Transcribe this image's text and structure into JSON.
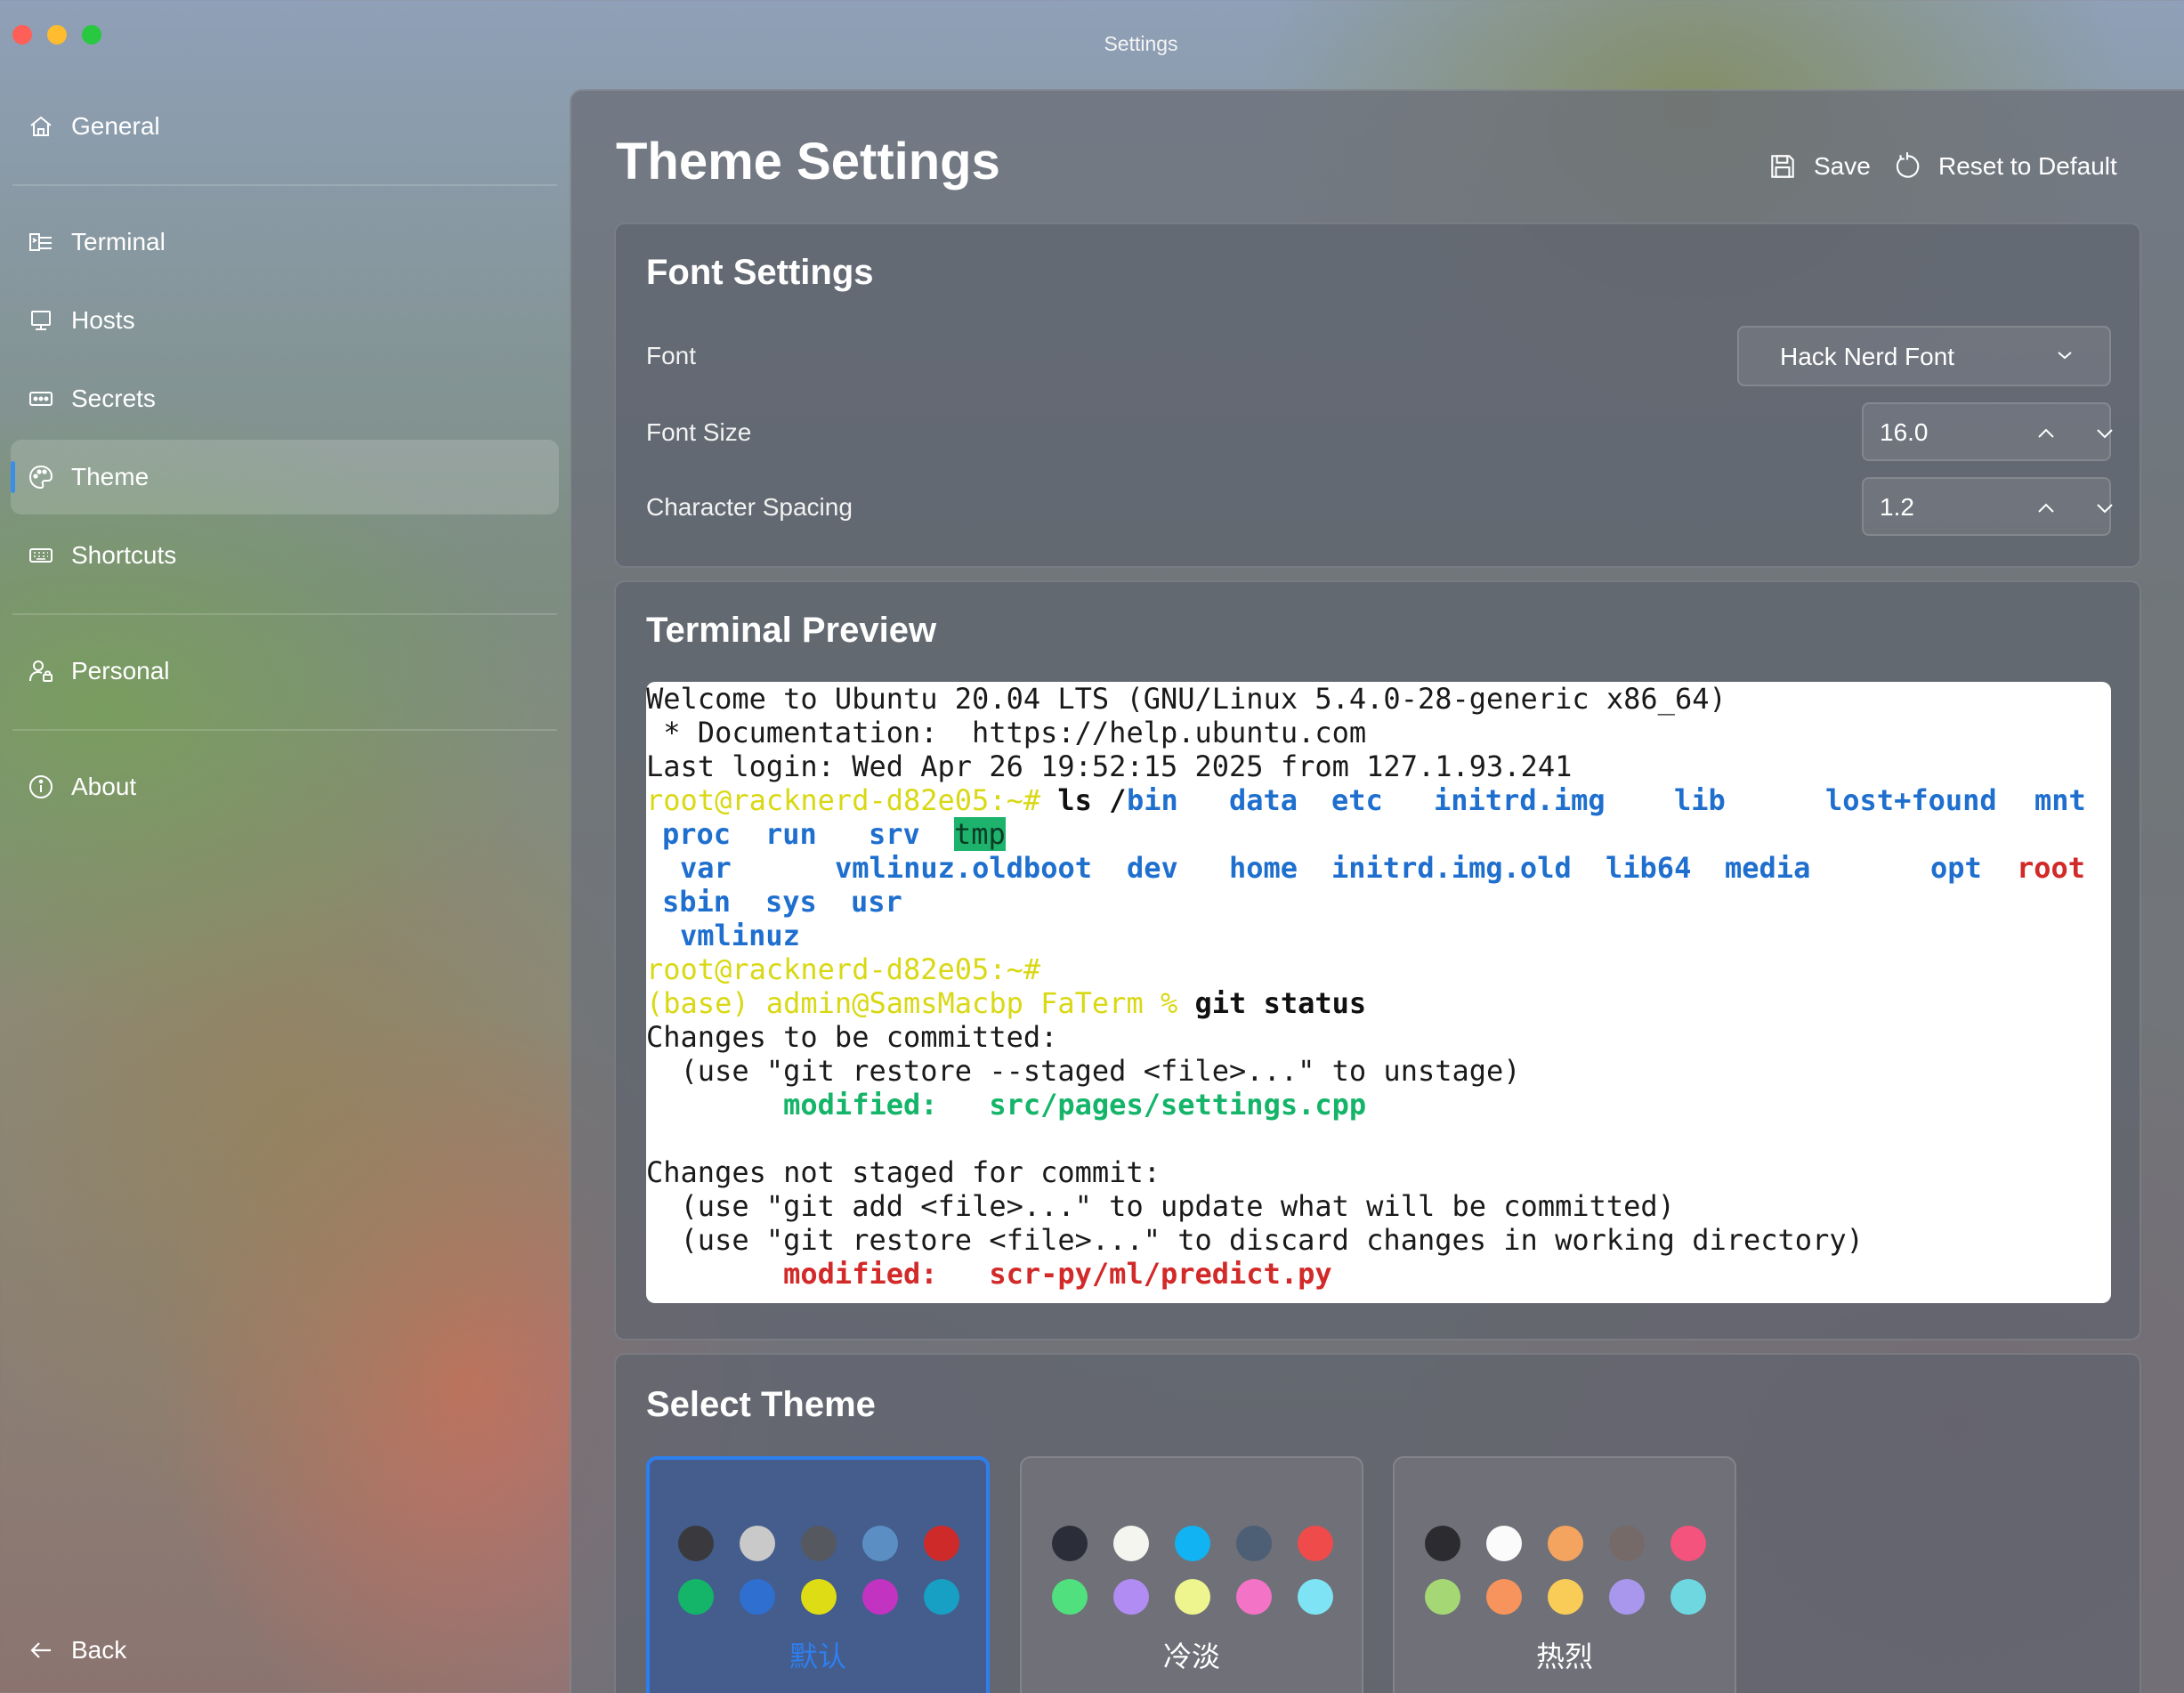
{
  "window": {
    "title": "Settings"
  },
  "sidebar": {
    "items": [
      {
        "label": "General",
        "icon": "home-icon"
      },
      {
        "label": "Terminal",
        "icon": "terminal-icon"
      },
      {
        "label": "Hosts",
        "icon": "monitor-icon"
      },
      {
        "label": "Secrets",
        "icon": "password-icon"
      },
      {
        "label": "Theme",
        "icon": "palette-icon",
        "active": true
      },
      {
        "label": "Shortcuts",
        "icon": "keyboard-icon"
      },
      {
        "label": "Personal",
        "icon": "person-lock-icon"
      },
      {
        "label": "About",
        "icon": "info-icon"
      }
    ],
    "back_label": "Back"
  },
  "header": {
    "title": "Theme Settings",
    "save_label": "Save",
    "reset_label": "Reset to Default"
  },
  "font_settings": {
    "title": "Font Settings",
    "font_label": "Font",
    "font_value": "Hack Nerd Font",
    "size_label": "Font Size",
    "size_value": "16.0",
    "spacing_label": "Character Spacing",
    "spacing_value": "1.2"
  },
  "terminal_preview": {
    "title": "Terminal Preview",
    "l1": "Welcome to Ubuntu 20.04 LTS (GNU/Linux 5.4.0-28-generic x86_64)",
    "l2": " * Documentation:  https://help.ubuntu.com",
    "l3": "Last login: Wed Apr 26 19:52:15 2025 from 127.1.93.241",
    "prompt1": "root@racknerd-d82e05:~#",
    "cmd1": " ls /",
    "ls_row1": [
      "bin",
      "data",
      "etc",
      "initrd.img",
      "lib",
      "lost+found",
      "mnt"
    ],
    "ls_row2": [
      "proc",
      "run",
      "srv",
      "tmp"
    ],
    "ls_row3": [
      "var",
      "vmlinuz.oldboot",
      "dev",
      "home",
      "initrd.img.old",
      "lib64",
      "media",
      "opt",
      "root"
    ],
    "ls_row4": [
      "sbin",
      "sys",
      "usr"
    ],
    "ls_row5": [
      "vmlinuz"
    ],
    "prompt2": "root@racknerd-d82e05:~#",
    "prompt3": "(base) admin@SamsMacbp FaTerm %",
    "cmd3": " git status",
    "g1": "Changes to be committed:",
    "g2": "  (use \"git restore --staged <file>...\" to unstage)",
    "g3_tag": "        modified:",
    "g3_file": "   src/pages/settings.cpp",
    "g4": "Changes not staged for commit:",
    "g5": "  (use \"git add <file>...\" to update what will be committed)",
    "g6": "  (use \"git restore <file>...\" to discard changes in working directory)",
    "g7_tag": "        modified:",
    "g7_file": "   scr-py/ml/predict.py"
  },
  "select_theme": {
    "title": "Select Theme",
    "themes": [
      {
        "name": "默认",
        "selected": true,
        "colors": [
          "#3a3a3e",
          "#c9c9c9",
          "#55585f",
          "#5b8fc4",
          "#cf2a2a",
          "#14b469",
          "#2f6fd0",
          "#dedc15",
          "#c233c2",
          "#17a0c4"
        ]
      },
      {
        "name": "冷淡",
        "selected": false,
        "colors": [
          "#2b2d38",
          "#f5f5f0",
          "#11b3f2",
          "#4d5f75",
          "#ef4b4b",
          "#51e07e",
          "#b18cf2",
          "#eef58e",
          "#f373c6",
          "#7ee4f5"
        ]
      },
      {
        "name": "热烈",
        "selected": false,
        "colors": [
          "#2c2c30",
          "#fbfbfb",
          "#f5a45f",
          "#766a68",
          "#f3537d",
          "#a5d875",
          "#f7935c",
          "#f8cc57",
          "#a997ee",
          "#6fd7e0"
        ]
      }
    ]
  },
  "colors": {
    "accent": "#2d7ff0"
  }
}
